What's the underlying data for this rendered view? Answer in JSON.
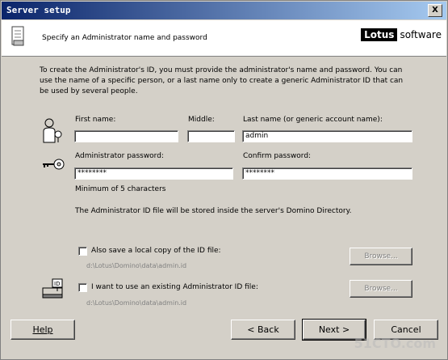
{
  "window": {
    "title": "Server setup",
    "close_glyph": "X"
  },
  "header": {
    "subtitle": "Specify an Administrator name and password",
    "brand_lotus": "Lotus",
    "brand_software": "software"
  },
  "intro": "To create the Administrator's ID, you must provide the administrator's name and password. You can use the name of a specific person, or a last name only to create a generic Administrator ID that can be used by several people.",
  "name_fields": {
    "first_label": "First name:",
    "first_value": "",
    "middle_label": "Middle:",
    "middle_value": "",
    "last_label": "Last name (or generic account name):",
    "last_value": "admin"
  },
  "password_fields": {
    "admin_label": "Administrator password:",
    "admin_value": "********",
    "confirm_label": "Confirm password:",
    "confirm_value": "********",
    "hint": "Minimum of 5 characters"
  },
  "storage_note": "The Administrator ID file will be stored inside the server's Domino Directory.",
  "local_copy": {
    "label": "Also save a local copy of the ID file:",
    "path": "d:\\Lotus\\Domino\\data\\admin.id",
    "browse": "Browse...",
    "checked": false
  },
  "existing_id": {
    "label": "I want to use an existing Administrator ID file:",
    "path": "d:\\Lotus\\Domino\\data\\admin.id",
    "browse": "Browse...",
    "checked": false
  },
  "buttons": {
    "help": "Help",
    "back": "< Back",
    "next": "Next >",
    "cancel": "Cancel"
  },
  "watermark": "51CTO.com",
  "icons": [
    "document-icon",
    "person-icon",
    "key-icon",
    "id-card-icon"
  ]
}
